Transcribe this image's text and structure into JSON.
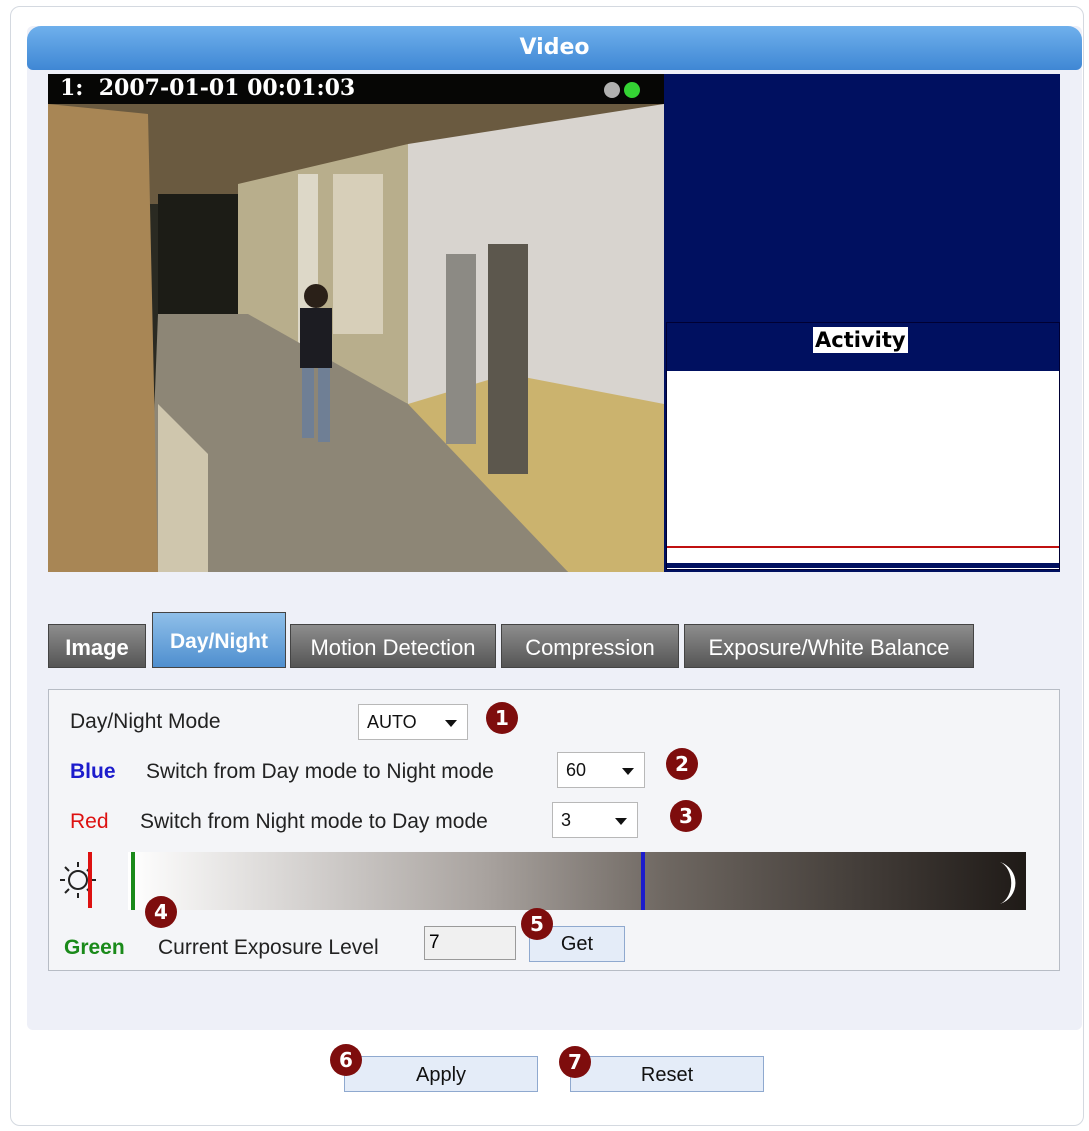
{
  "title": "Video",
  "camera": {
    "osd_text": "1:  2007-01-01 00:01:03"
  },
  "activity": {
    "title": "Activity"
  },
  "tabs": [
    {
      "label": "Image",
      "active": false
    },
    {
      "label": "Day/Night",
      "active": true
    },
    {
      "label": "Motion Detection",
      "active": false
    },
    {
      "label": "Compression",
      "active": false
    },
    {
      "label": "Exposure/White Balance",
      "active": false
    }
  ],
  "settings": {
    "mode_label": "Day/Night Mode",
    "mode_value": "AUTO",
    "blue_color_label": "Blue",
    "blue_desc": "Switch from Day mode to Night mode",
    "blue_value": "60",
    "red_color_label": "Red",
    "red_desc": "Switch from Night mode to Day mode",
    "red_value": "3",
    "green_color_label": "Green",
    "exposure_label": "Current Exposure Level",
    "exposure_value": "7",
    "get_label": "Get"
  },
  "markers": {
    "green": 7,
    "blue": 60
  },
  "colors": {
    "blue": "#1c1ccc",
    "red": "#dd1111",
    "green": "#1a8a1a"
  },
  "badges": [
    "1",
    "2",
    "3",
    "4",
    "5",
    "6",
    "7"
  ],
  "actions": {
    "apply_label": "Apply",
    "reset_label": "Reset"
  }
}
